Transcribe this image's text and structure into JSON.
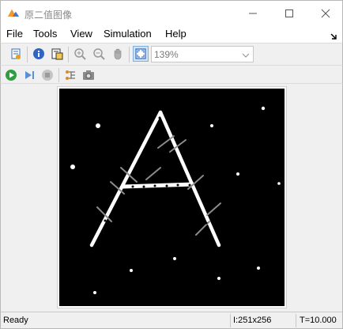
{
  "window": {
    "title": "原二值图像"
  },
  "menu": [
    "File",
    "Tools",
    "View",
    "Simulation",
    "Help"
  ],
  "toolbar": {
    "zoom_value": "139%"
  },
  "status": {
    "state": "Ready",
    "pixel_info": "I:251x256",
    "time": "T=10.000"
  },
  "colors": {
    "image_background": "#000000",
    "image_foreground": "#ffffff",
    "window_background": "#f0f0f0"
  },
  "icons": {
    "titlebar": [
      "app-icon",
      "minimize-icon",
      "maximize-icon",
      "close-icon"
    ],
    "toolbar_row1": [
      "parameters-icon",
      "info-icon",
      "export-icon",
      "zoom-in-icon",
      "zoom-out-icon",
      "pan-icon",
      "fit-to-window-icon"
    ],
    "toolbar_row2": [
      "run-icon",
      "step-forward-icon",
      "stop-icon",
      "signal-select-icon",
      "snapshot-icon"
    ]
  }
}
